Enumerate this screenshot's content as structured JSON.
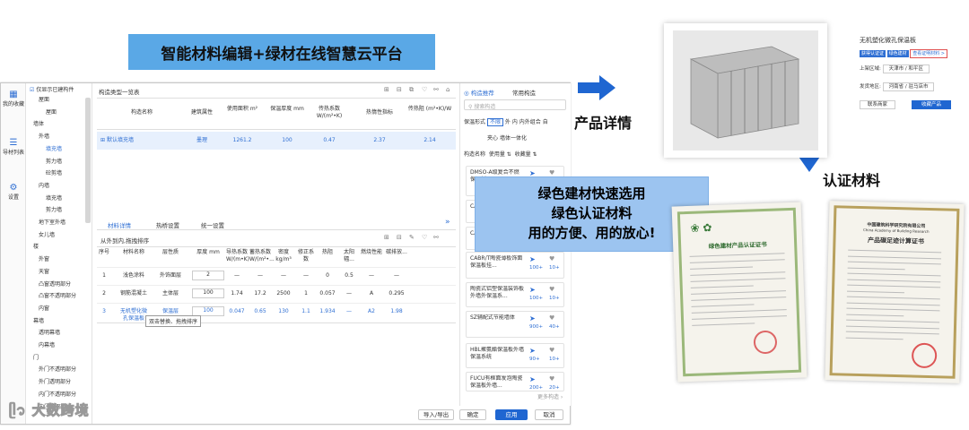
{
  "banner": {
    "title": "智能材料编辑+绿材在线智慧云平台"
  },
  "rail": {
    "items": [
      "我的收藏",
      "导材列表",
      "设置"
    ]
  },
  "tree": {
    "header": "仅显示已建构件",
    "items": [
      "屋面",
      "屋面",
      "墙体",
      "外墙",
      "填充墙",
      "剪力墙",
      "砼剪墙",
      "内墙",
      "填充墙",
      "剪力墙",
      "地下室外墙",
      "女儿墙",
      "楼",
      "外窗",
      "天窗",
      "凸窗透明部分",
      "凸窗不透明部分",
      "内窗",
      "幕墙",
      "透明幕墙",
      "内幕墙",
      "门",
      "外门不透明部分",
      "外门透明部分",
      "内门不透明部分",
      "内门透明部分"
    ]
  },
  "table1": {
    "title": "构造类型一览表",
    "headers": [
      "构造名称",
      "建筑属性",
      "使用面积 m²",
      "保温厚度 mm",
      "传热系数 W/(m²•K)",
      "热惰性指标",
      "传热阻 (m²•K)/W"
    ],
    "row": [
      "默认填充墙",
      "墨理",
      "1261.2",
      "100",
      "0.47",
      "2.37",
      "2.14"
    ]
  },
  "tabs2": {
    "items": [
      "材料详情",
      "热桥设置",
      "统一设置"
    ]
  },
  "table2": {
    "subtitle": "从外到内,拖拽排序",
    "headers": [
      "序号",
      "材料名称",
      "层性质",
      "厚度 mm",
      "导热系数 W/(m•K)",
      "蓄热系数 W/(m²•...",
      "密度 kg/m³",
      "修正系数",
      "热阻",
      "太阳辐...",
      "燃烧性能",
      "碳排放..."
    ],
    "rows": [
      [
        "1",
        "浅色涂料",
        "外饰面层",
        "2",
        "—",
        "—",
        "—",
        "—",
        "0",
        "0.5",
        "—",
        "—"
      ],
      [
        "2",
        "钢筋混凝土",
        "主体层",
        "100",
        "1.74",
        "17.2",
        "2500",
        "1",
        "0.057",
        "—",
        "A",
        "0.295"
      ],
      [
        "3",
        "无机塑化微孔保温板",
        "保温层",
        "100",
        "0.047",
        "0.65",
        "130",
        "1.1",
        "1.934",
        "—",
        "A2",
        "1.98"
      ]
    ],
    "tooltip": "双击替换、拖拽排序"
  },
  "footer": {
    "import_export": "导入/导出",
    "ok": "确定",
    "apply": "应用",
    "cancel": "取消"
  },
  "right": {
    "tabs": [
      "构造推荐",
      "常用构造"
    ],
    "search_placeholder": "搜索构造",
    "filter_label": "保温形式",
    "filters": [
      "不限",
      "外",
      "内",
      "内外组合",
      "自"
    ],
    "filters2": [
      "夹心",
      "墙体一体化"
    ],
    "sort": [
      "构造名称",
      "使用量",
      "收藏量"
    ],
    "cards": [
      {
        "name": "DMSO-A级复合不燃保温板...",
        "used": "100+",
        "fav": "10+"
      },
      {
        "name": "CAB...",
        "used": "",
        "fav": ""
      },
      {
        "name": "CAB...",
        "used": "",
        "fav": ""
      },
      {
        "name": "CABR/T陶瓷薄板饰面保温板挂...",
        "used": "100+",
        "fav": "10+"
      },
      {
        "name": "陶瓷式铝塑保温装饰板外墙外保温系...",
        "used": "100+",
        "fav": "10+"
      },
      {
        "name": "SZ辅配式节能墙体",
        "used": "900+",
        "fav": "40+"
      },
      {
        "name": "HBL聚氨酯保温板外墙保温系统",
        "used": "90+",
        "fav": "10+"
      },
      {
        "name": "FUCU有框面发泡陶瓷保温板外墙...",
        "used": "200+",
        "fav": "20+"
      }
    ],
    "more": "更多构造"
  },
  "popup": {
    "lines": [
      "绿色建材快速选用",
      "绿色认证材料",
      "用的方便、用的放心!"
    ]
  },
  "labels": {
    "product": "产品详情",
    "cert": "认证材料"
  },
  "detail": {
    "title": "无机塑化微孔保温板",
    "tags": [
      "获得认证证",
      "绿色建材",
      "查看证明材料 >"
    ],
    "field1_label": "上架区域:",
    "field1_value": "天津市 / 和平区",
    "field2_label": "发货地区:",
    "field2_value": "河南省 / 驻马店市",
    "contact": "联系商家",
    "add": "收藏产品"
  },
  "cert1": {
    "title": "绿色建材产品认证证书"
  },
  "cert2": {
    "org": "中国建筑科学研究院有限公司",
    "org_en": "China Academy of Building Research",
    "title": "产品碳足迹计算证书"
  },
  "watermark": "大数跨境",
  "colors": {
    "accent": "#1f66d1",
    "banner": "#5aa8e6",
    "popup": "#9cc4f0"
  }
}
